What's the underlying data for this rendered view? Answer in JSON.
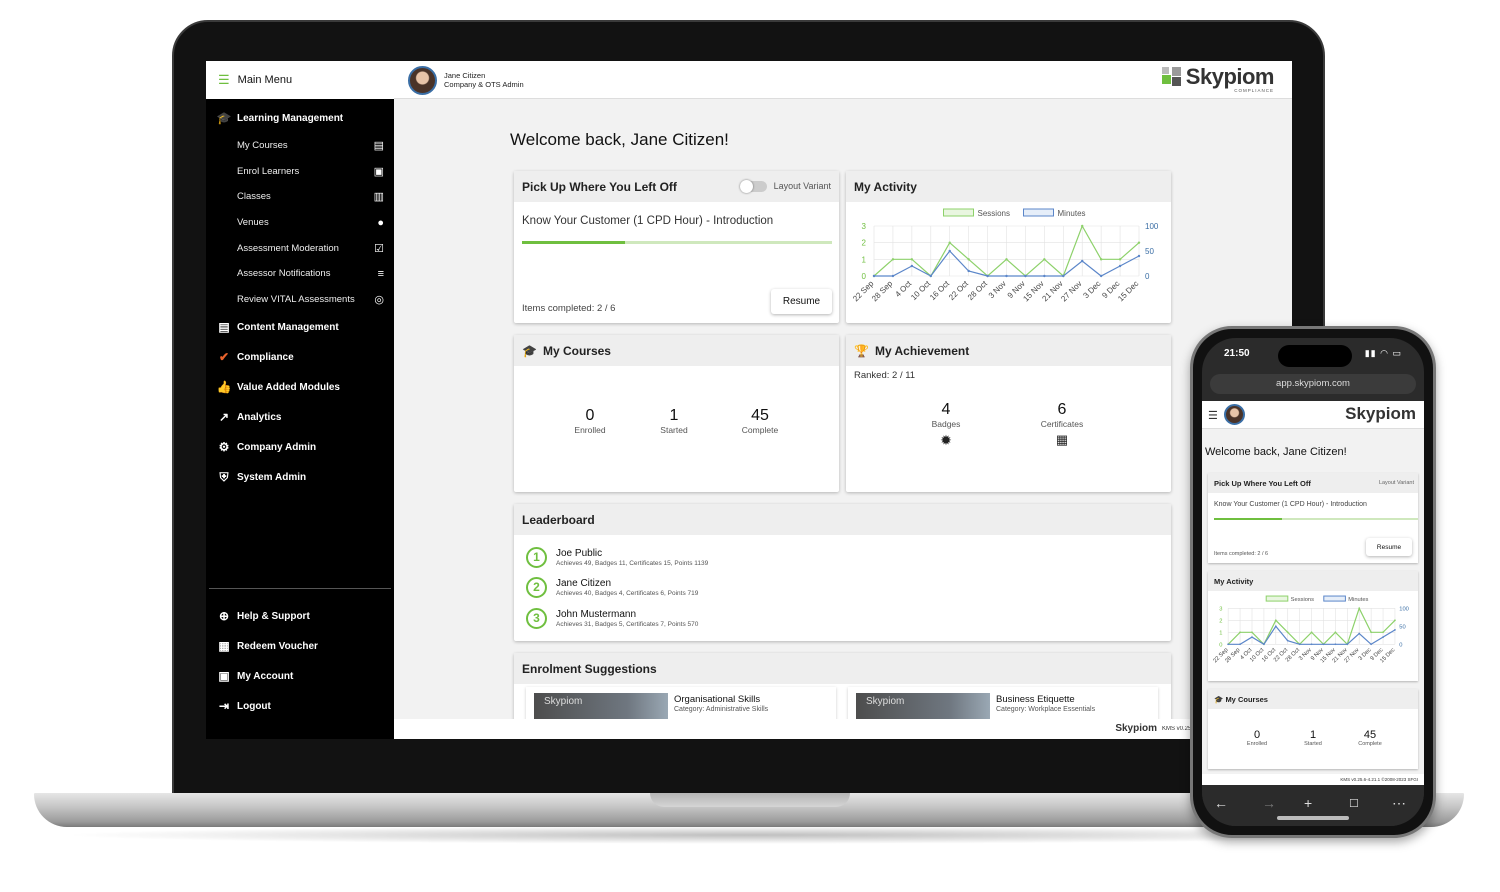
{
  "sidebar": {
    "menu_title": "Main Menu",
    "sections": [
      {
        "label": "Learning Management",
        "icon": "graduation-cap-icon"
      },
      {
        "label": "Content Management",
        "icon": "document-list-icon"
      },
      {
        "label": "Compliance",
        "icon": "checkmark-icon"
      },
      {
        "label": "Value Added Modules",
        "icon": "thumbs-up-icon"
      },
      {
        "label": "Analytics",
        "icon": "trend-line-icon"
      },
      {
        "label": "Company Admin",
        "icon": "company-settings-icon"
      },
      {
        "label": "System Admin",
        "icon": "shield-icon"
      }
    ],
    "sub_items": [
      {
        "label": "My Courses",
        "icon": "book-icon"
      },
      {
        "label": "Enrol Learners",
        "icon": "clipboard-user-icon"
      },
      {
        "label": "Classes",
        "icon": "presenter-icon"
      },
      {
        "label": "Venues",
        "icon": "location-pin-icon"
      },
      {
        "label": "Assessment Moderation",
        "icon": "checklist-icon"
      },
      {
        "label": "Assessor Notifications",
        "icon": "list-cancel-icon"
      },
      {
        "label": "Review VITAL Assessments",
        "icon": "fingerprint-icon"
      }
    ],
    "bottom_items": [
      {
        "label": "Help & Support",
        "icon": "lifebuoy-icon"
      },
      {
        "label": "Redeem Voucher",
        "icon": "ticket-icon"
      },
      {
        "label": "My Account",
        "icon": "account-icon"
      },
      {
        "label": "Logout",
        "icon": "logout-icon"
      }
    ]
  },
  "topbar": {
    "user_name": "Jane Citizen",
    "user_role": "Company & OTS Admin",
    "brand": "Skypiom",
    "brand_sub": "COMPLIANCE"
  },
  "welcome": "Welcome back, Jane Citizen!",
  "pickup": {
    "title": "Pick Up Where You Left Off",
    "toggle_label": "Layout Variant",
    "course": "Know Your Customer (1 CPD Hour) - Introduction",
    "progress": 0.333,
    "items_completed": "Items completed: 2 / 6",
    "resume_label": "Resume"
  },
  "activity": {
    "title": "My Activity",
    "legend": [
      "Sessions",
      "Minutes"
    ],
    "colors": {
      "sessions": "#8dd16a",
      "minutes": "#5b86c9"
    },
    "chart_data": {
      "type": "line",
      "x": [
        "22 Sep",
        "28 Sep",
        "4 Oct",
        "10 Oct",
        "16 Oct",
        "22 Oct",
        "28 Oct",
        "3 Nov",
        "9 Nov",
        "15 Nov",
        "21 Nov",
        "27 Nov",
        "3 Dec",
        "9 Dec",
        "15 Dec"
      ],
      "series": [
        {
          "name": "Sessions",
          "axis": "left",
          "values": [
            0,
            1,
            1,
            0,
            2,
            1,
            0,
            1,
            0,
            1,
            0,
            3,
            1,
            1,
            2
          ]
        },
        {
          "name": "Minutes",
          "axis": "right",
          "values": [
            0,
            0,
            20,
            0,
            50,
            10,
            0,
            0,
            0,
            0,
            0,
            30,
            0,
            20,
            40
          ]
        }
      ],
      "y_left_ticks": [
        "0",
        "1",
        "2",
        "3"
      ],
      "y_right_ticks": [
        "0",
        "50",
        "100"
      ],
      "ylim_left": [
        0,
        3
      ],
      "ylim_right": [
        0,
        100
      ]
    }
  },
  "my_courses": {
    "title": "My Courses",
    "stats": [
      {
        "value": "0",
        "label": "Enrolled"
      },
      {
        "value": "1",
        "label": "Started"
      },
      {
        "value": "45",
        "label": "Complete"
      }
    ]
  },
  "achievement": {
    "title": "My Achievement",
    "ranked": "Ranked: 2 / 11",
    "stats": [
      {
        "value": "4",
        "label": "Badges"
      },
      {
        "value": "6",
        "label": "Certificates"
      }
    ]
  },
  "leaderboard": {
    "title": "Leaderboard",
    "rows": [
      {
        "rank": "1",
        "name": "Joe Public",
        "detail": "Achieves 49, Badges 11, Certificates 15, Points 1139"
      },
      {
        "rank": "2",
        "name": "Jane Citizen",
        "detail": "Achieves 40, Badges 4, Certificates 6, Points 719"
      },
      {
        "rank": "3",
        "name": "John Mustermann",
        "detail": "Achieves 31, Badges 5, Certificates 7, Points 570"
      }
    ]
  },
  "suggestions": {
    "title": "Enrolment Suggestions",
    "items": [
      {
        "thumb": "Skypiom",
        "title": "Organisational Skills",
        "category": "Category: Administrative Skills"
      },
      {
        "thumb": "Skypiom",
        "title": "Business Etiquette",
        "category": "Category: Workplace Essentials"
      }
    ]
  },
  "footer": {
    "brand": "Skypiom",
    "version": "KMS v0.25.6-4.21.1 ©2008-2023 SFGI 2"
  },
  "phone": {
    "time": "21:50",
    "url": "app.skypiom.com",
    "brand": "Skypiom",
    "welcome": "Welcome back, Jane Citizen!",
    "pickup_title": "Pick Up Where You Left Off",
    "toggle_label": "Layout Variant",
    "course": "Know Your Customer (1 CPD Hour) - Introduction",
    "items_completed": "Items completed: 2 / 6",
    "resume_label": "Resume",
    "activity_title": "My Activity",
    "courses_title": "My Courses",
    "footer_version": "KMS v0.25.6-4.21.1 ©2008-2023 SFGI"
  }
}
